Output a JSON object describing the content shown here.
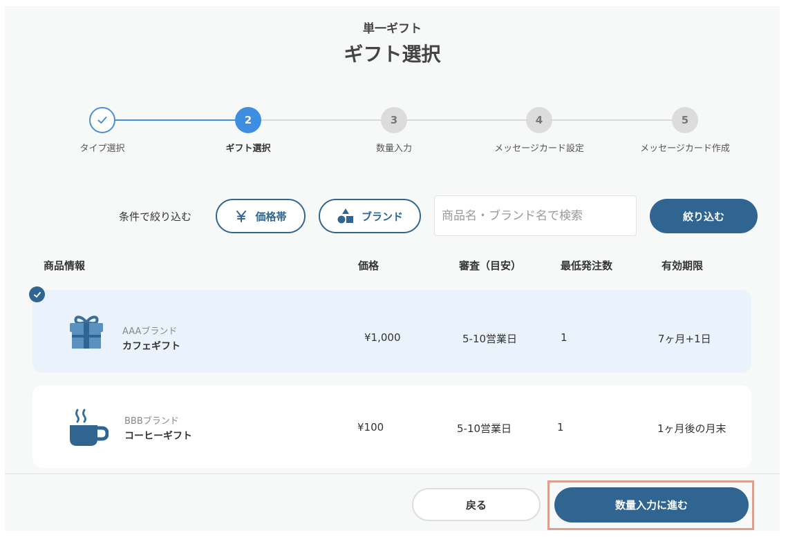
{
  "header": {
    "subtitle": "単一ギフト",
    "title": "ギフト選択"
  },
  "stepper": {
    "steps": [
      {
        "number": "",
        "label": "タイプ選択",
        "state": "done"
      },
      {
        "number": "2",
        "label": "ギフト選択",
        "state": "active"
      },
      {
        "number": "3",
        "label": "数量入力",
        "state": "pending"
      },
      {
        "number": "4",
        "label": "メッセージカード設定",
        "state": "pending"
      },
      {
        "number": "5",
        "label": "メッセージカード作成",
        "state": "pending"
      }
    ]
  },
  "filter": {
    "label": "条件で絞り込む",
    "price_button": "価格帯",
    "brand_button": "ブランド",
    "search_placeholder": "商品名・ブランド名で検索",
    "submit_button": "絞り込む"
  },
  "table": {
    "headers": [
      "商品情報",
      "価格",
      "審査（目安）",
      "最低発注数",
      "有効期限"
    ],
    "rows": [
      {
        "brand": "AAAブランド",
        "name": "カフェギフト",
        "price": "¥1,000",
        "review": "5-10営業日",
        "min_order": "1",
        "expiry": "7ヶ月+1日",
        "selected": true,
        "icon": "gift-icon"
      },
      {
        "brand": "BBBブランド",
        "name": "コーヒーギフト",
        "price": "¥100",
        "review": "5-10営業日",
        "min_order": "1",
        "expiry": "1ヶ月後の月末",
        "selected": false,
        "icon": "coffee-cup-icon"
      }
    ]
  },
  "footer": {
    "back_button": "戻る",
    "next_button": "数量入力に進む"
  },
  "colors": {
    "primary": "#2f6590",
    "step_active": "#3d8de0",
    "selected_row": "#eaf2fb",
    "highlight_outline": "#d9a08d"
  }
}
